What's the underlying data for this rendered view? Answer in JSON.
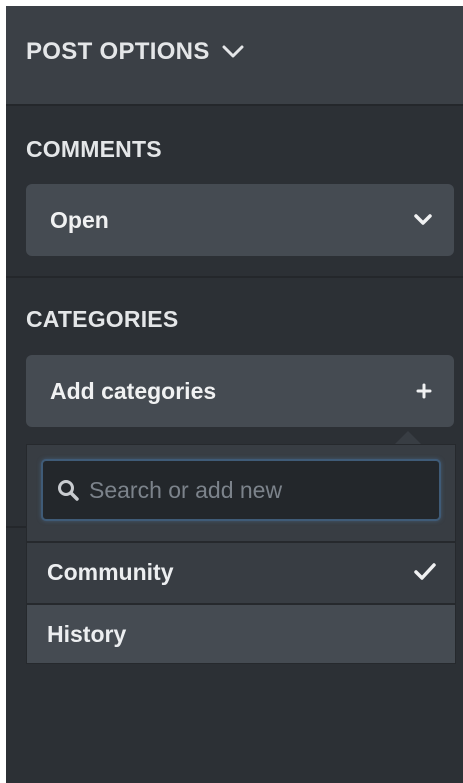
{
  "header": {
    "title": "POST OPTIONS",
    "chevron_icon": "chevron-down-icon"
  },
  "comments": {
    "label": "COMMENTS",
    "selected_value": "Open",
    "chevron_icon": "chevron-down-icon"
  },
  "categories": {
    "label": "CATEGORIES",
    "add_label": "Add categories",
    "add_icon": "plus-icon",
    "dropdown": {
      "search_placeholder": "Search or add new",
      "search_value": "",
      "search_icon": "search-icon",
      "options": [
        {
          "label": "Community",
          "checked": true,
          "check_icon": "checkmark-icon"
        },
        {
          "label": "History",
          "checked": false
        }
      ]
    }
  },
  "colors": {
    "panel_bg": "#2c3035",
    "header_bg": "#3b4046",
    "control_bg": "#454b52",
    "input_bg": "#23272b",
    "focus_border": "#3f5b77",
    "text": "#e4e6e8",
    "placeholder": "#7c838b"
  }
}
